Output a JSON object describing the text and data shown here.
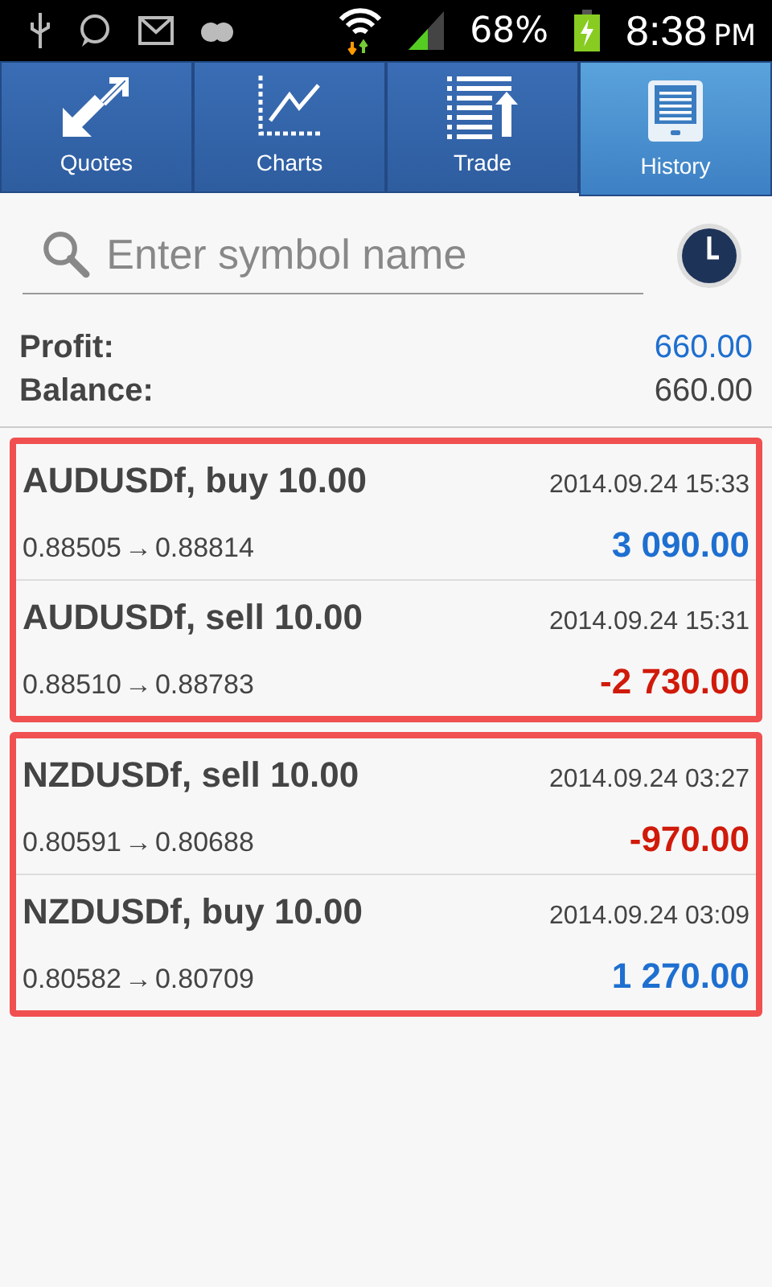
{
  "status_bar": {
    "battery": "68%",
    "time": "8:38",
    "ampm": "PM"
  },
  "tabs": [
    {
      "label": "Quotes",
      "kind": "quotes",
      "selected": false
    },
    {
      "label": "Charts",
      "kind": "charts",
      "selected": false
    },
    {
      "label": "Trade",
      "kind": "trade",
      "selected": false
    },
    {
      "label": "History",
      "kind": "history",
      "selected": true
    }
  ],
  "search": {
    "placeholder": "Enter symbol name"
  },
  "summary": [
    {
      "label": "Profit:",
      "value": "660.00",
      "color": "#1e6fd0"
    },
    {
      "label": "Balance:",
      "value": "660.00",
      "color": "#444444"
    }
  ],
  "highlight_groups": [
    {
      "deals": [
        {
          "title": "AUDUSDf, buy 10.00",
          "time": "2014.09.24 15:33",
          "open": "0.88505",
          "arrow": "→",
          "close": "0.88814",
          "result": "3 090.00",
          "color": "#1e6fd0"
        },
        {
          "title": "AUDUSDf, sell 10.00",
          "time": "2014.09.24 15:31",
          "open": "0.88510",
          "arrow": "→",
          "close": "0.88783",
          "result": "-2 730.00",
          "color": "#d01a0a"
        }
      ]
    },
    {
      "deals": [
        {
          "title": "NZDUSDf, sell 10.00",
          "time": "2014.09.24 03:27",
          "open": "0.80591",
          "arrow": "→",
          "close": "0.80688",
          "result": "-970.00",
          "color": "#d01a0a"
        },
        {
          "title": "NZDUSDf, buy 10.00",
          "time": "2014.09.24 03:09",
          "open": "0.80582",
          "arrow": "→",
          "close": "0.80709",
          "result": "1 270.00",
          "color": "#1e6fd0"
        }
      ]
    }
  ]
}
